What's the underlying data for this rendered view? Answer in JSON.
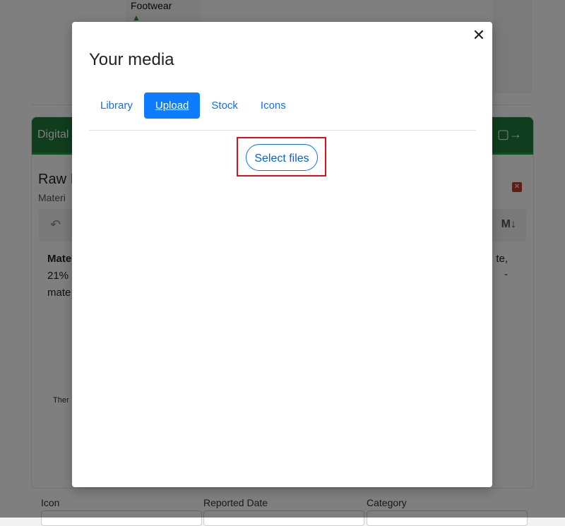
{
  "background": {
    "top_card_label": "Footwear",
    "panel_header_title": "Digital",
    "content_title": "Raw I",
    "content_subtitle": "Materi",
    "body_lines": [
      "Mate",
      "21%",
      "mate"
    ],
    "body_right_lines": [
      "te,",
      "-"
    ],
    "small_text": "Ther",
    "toolbar_md": "M↓",
    "undo_glyph": "↶",
    "fields": [
      "Icon",
      "Reported Date",
      "Category"
    ]
  },
  "modal": {
    "title": "Your media",
    "close_glyph": "✕",
    "tabs": [
      {
        "label": "Library",
        "active": false
      },
      {
        "label": "Upload",
        "active": true
      },
      {
        "label": "Stock",
        "active": false
      },
      {
        "label": "Icons",
        "active": false
      }
    ],
    "select_files_label": "Select files"
  },
  "colors": {
    "accent": "#0d7cff",
    "highlight": "#e0101a",
    "header_green": "#1f7a3a"
  }
}
